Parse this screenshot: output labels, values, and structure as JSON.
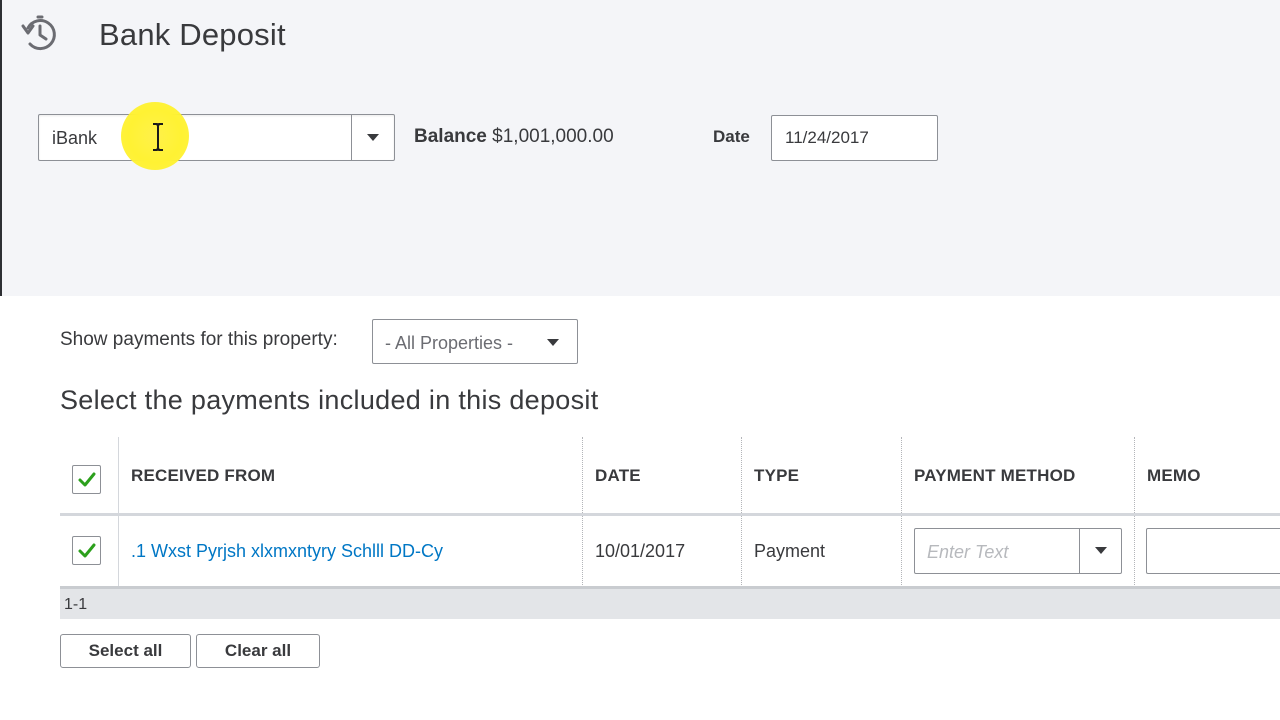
{
  "header": {
    "icon": "history-icon",
    "title": "Bank Deposit"
  },
  "deposit_form": {
    "account_value": "iBank",
    "balance_label": "Balance",
    "balance_value": "$1,001,000.00",
    "date_label": "Date",
    "date_value": "11/24/2017"
  },
  "property_filter": {
    "label": "Show payments for this property:",
    "selected": "- All Properties -"
  },
  "section_heading": "Select the payments included in this deposit",
  "table": {
    "columns": [
      "RECEIVED FROM",
      "DATE",
      "TYPE",
      "PAYMENT METHOD",
      "MEMO"
    ],
    "header_checked": true,
    "rows": [
      {
        "checked": true,
        "received_from": ".1 Wxst Pyrjsh xlxmxntyry Schlll DD-Cy",
        "date": "10/01/2017",
        "type": "Payment",
        "payment_method_placeholder": "Enter Text",
        "memo": ""
      }
    ],
    "pagination": "1-1"
  },
  "actions": {
    "select_all": "Select all",
    "clear_all": "Clear all"
  },
  "colors": {
    "accent_link": "#0077c5",
    "check_green": "#2ca01c",
    "panel_bg": "#f4f5f8",
    "cursor_highlight": "#fff233"
  }
}
